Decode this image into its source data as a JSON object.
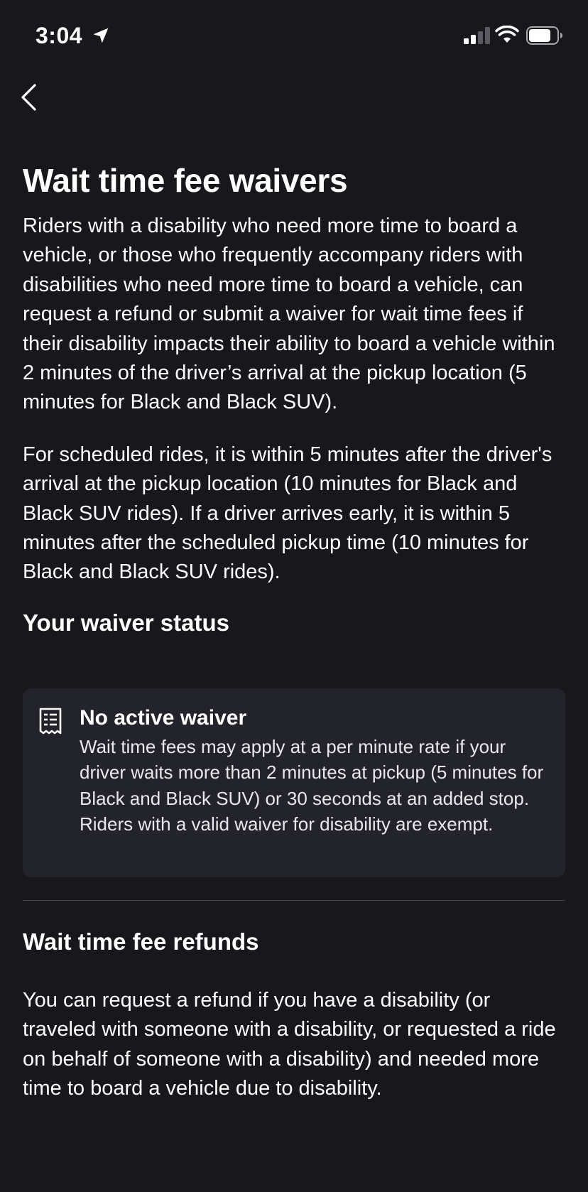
{
  "status_bar": {
    "time": "3:04",
    "location_icon": "location-arrow-icon",
    "signal_icon": "cellular-signal-icon",
    "wifi_icon": "wifi-icon",
    "battery_icon": "battery-icon"
  },
  "nav": {
    "back_icon": "chevron-left-icon"
  },
  "page": {
    "title": "Wait time fee waivers",
    "intro_paragraph": "Riders with a disability who need more time to board a vehicle, or those who frequently accompany riders with disabilities who need more time to board a vehicle, can request a refund or submit a waiver for wait time fees if their disability impacts their ability to board a vehicle within 2 minutes of the driver’s arrival at the pickup location (5 minutes for Black and Black SUV).",
    "scheduled_paragraph": "For scheduled rides, it is within 5 minutes after the driver's arrival at the pickup location (10 minutes for Black and Black SUV rides). If a driver arrives early, it is within 5 minutes after the scheduled pickup time (10 minutes for Black and Black SUV rides)."
  },
  "waiver_status": {
    "heading": "Your waiver status",
    "card": {
      "icon": "document-icon",
      "title": "No active waiver",
      "text": "Wait time fees may apply at a per minute rate if your driver waits more than 2 minutes at pickup (5 minutes for Black and Black SUV) or 30 seconds at an added stop. Riders with a valid waiver for disability are exempt."
    }
  },
  "refunds": {
    "heading": "Wait time fee refunds",
    "paragraph": "You can request a refund if you have a disability (or traveled with someone with a disability, or requested a ride on behalf of someone with a disability) and needed more time to board a vehicle due to disability."
  },
  "colors": {
    "background": "#17171c",
    "card_background": "#23232b",
    "text": "#ffffff",
    "divider": "#44444c"
  }
}
